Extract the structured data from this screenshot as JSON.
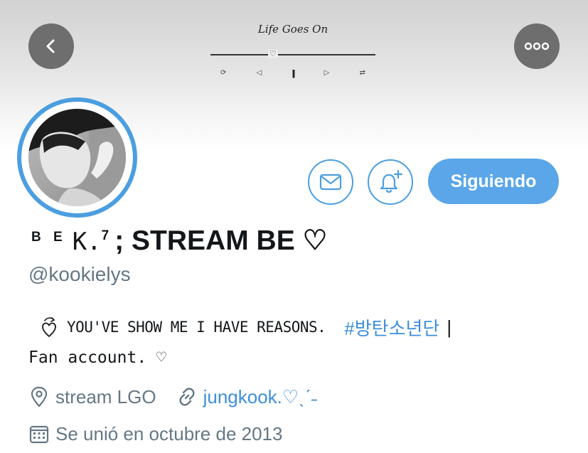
{
  "header": {
    "back_icon": "chevron-left-icon",
    "more_icon": "more-horizontal-icon",
    "player": {
      "song_title": "Life Goes On",
      "progress_marker": "♡",
      "progress_fraction": 0.38,
      "controls": {
        "repeat": "⟳",
        "previous": "◁",
        "pause": "||",
        "next": "▷",
        "shuffle": "⇄"
      }
    }
  },
  "profile": {
    "display_name": {
      "letters": "B E",
      "k": "K.",
      "sup": "7",
      "main": "; STREAM BE ♡"
    },
    "handle": "@kookielys",
    "bio": {
      "caps_text": "YOU'VE SHOW ME I HAVE REASONS.",
      "hashtag": "#방탄소년단",
      "pipe": "|",
      "line2": "Fan account. ♡"
    },
    "location": "stream LGO",
    "website": "jungkook.♡ˎˊ˗",
    "joined": "Se unió en octubre de 2013"
  },
  "actions": {
    "follow_label": "Siguiendo",
    "message_icon": "mail-icon",
    "notify_icon": "bell-plus-icon"
  },
  "colors": {
    "accent": "#4b9ee0",
    "follow_bg": "#5aa6e8",
    "link": "#3d8fdb",
    "muted": "#657786",
    "header_button_bg": "#6e6e6e"
  }
}
